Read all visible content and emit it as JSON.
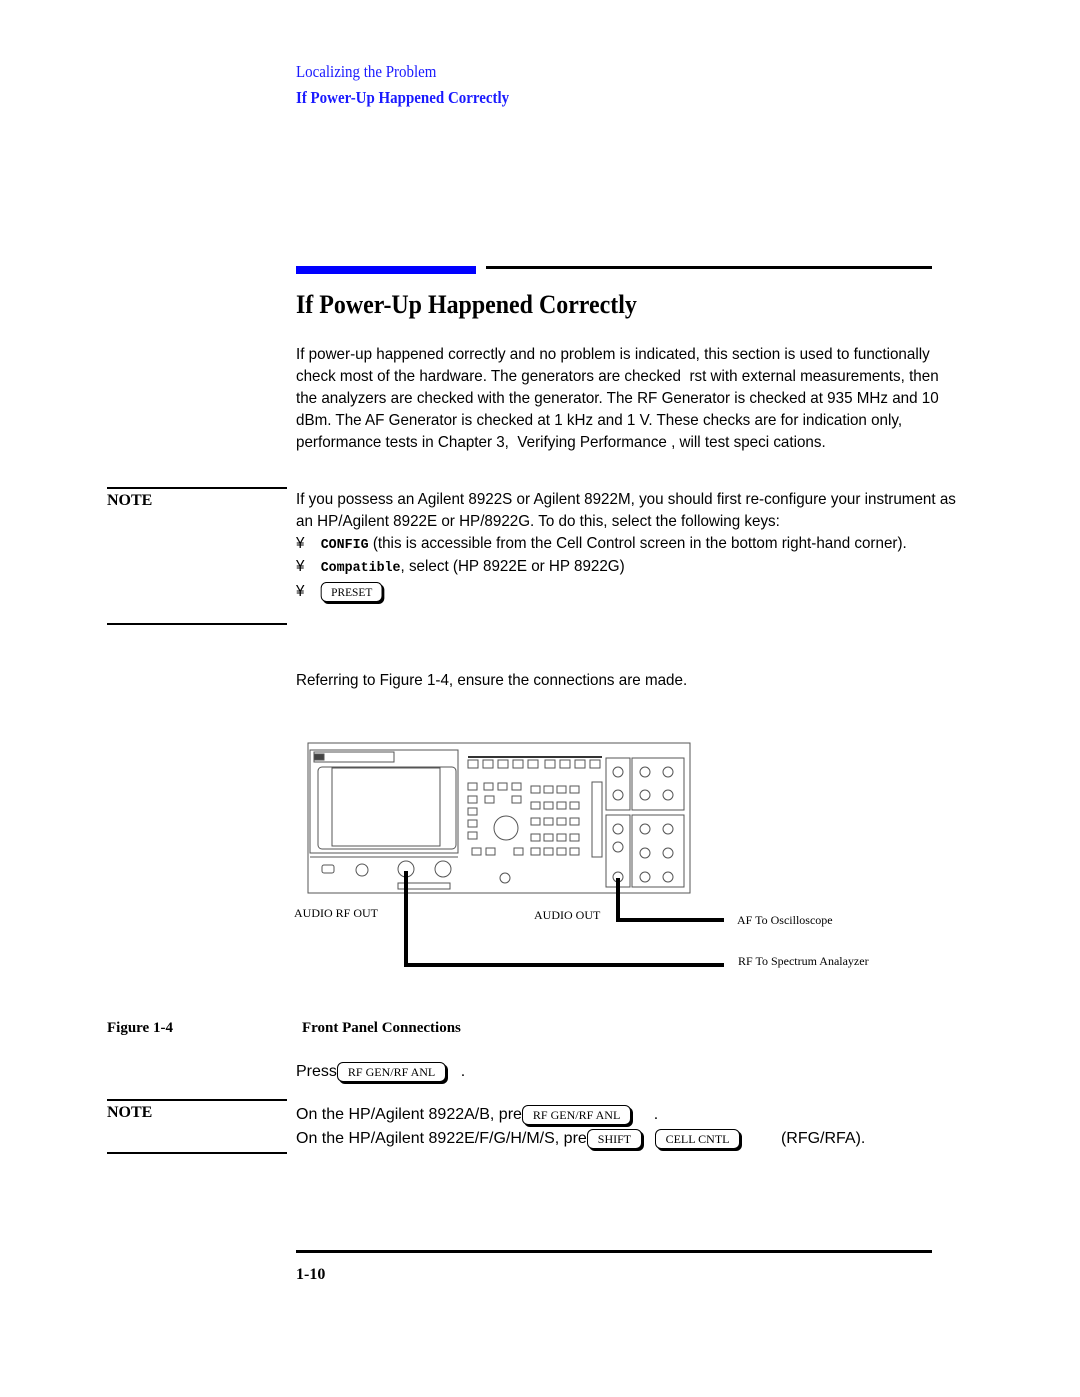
{
  "header": {
    "chapter_section": "Localizing the Problem",
    "current_topic": "If Power-Up Happened Correctly"
  },
  "section": {
    "title": "If Power-Up Happened Correctly",
    "intro_paragraph": "If power-up happened correctly and no problem is indicated, this section is used to functionally check most of the hardware. The generators are checked  rst with external measurements, then the analyzers are checked with the generator. The RF Generator is checked at 935 MHz and 10 dBm. The AF Generator is checked at 1 kHz and 1 V. These checks are for indication only, performance tests in Chapter 3,  Verifying Performance , will test speci cations."
  },
  "note1": {
    "label": "NOTE",
    "text": "If you possess an Agilent 8922S or Agilent 8922M, you should first re-configure your instrument as an HP/Agilent 8922E or  HP/8922G. To do this, select the following keys:",
    "bullet_glyph": "¥",
    "items": [
      {
        "keyword": "CONFIG",
        "text": " (this is accessible from the Cell Control screen in the bottom right-hand corner)."
      },
      {
        "keyword": "Compatible",
        "text": ", select (HP 8922E or HP 8922G)"
      },
      {
        "key": "PRESET"
      }
    ]
  },
  "referring_text": "Referring to Figure 1-4, ensure the connections are made.",
  "figure": {
    "number_label": "Figure 1-4",
    "title": "Front Panel Connections",
    "labels": {
      "audio_rf_out": "AUDIO RF OUT",
      "audio_out": "AUDIO OUT",
      "af_to_scope": "AF To Oscilloscope",
      "rf_to_analyzer": "RF To Spectrum Analayzer"
    }
  },
  "press_line": {
    "prefix": "Press",
    "key": "RF GEN/RF ANL",
    "suffix": "."
  },
  "note2": {
    "label": "NOTE",
    "line1_prefix": "On the HP/Agilent 8922A/B, pre",
    "line1_key": "RF GEN/RF ANL",
    "line1_suffix": ".",
    "line2_prefix": "On the HP/Agilent 8922E/F/G/H/M/S, pre",
    "line2_key1": "SHIFT",
    "line2_key2": "CELL CNTL",
    "line2_suffix": "(RFG/RFA)."
  },
  "footer": {
    "page_number": "1-10"
  },
  "colors": {
    "accent_blue": "#0000ff",
    "header_blue": "#1a1aff"
  }
}
